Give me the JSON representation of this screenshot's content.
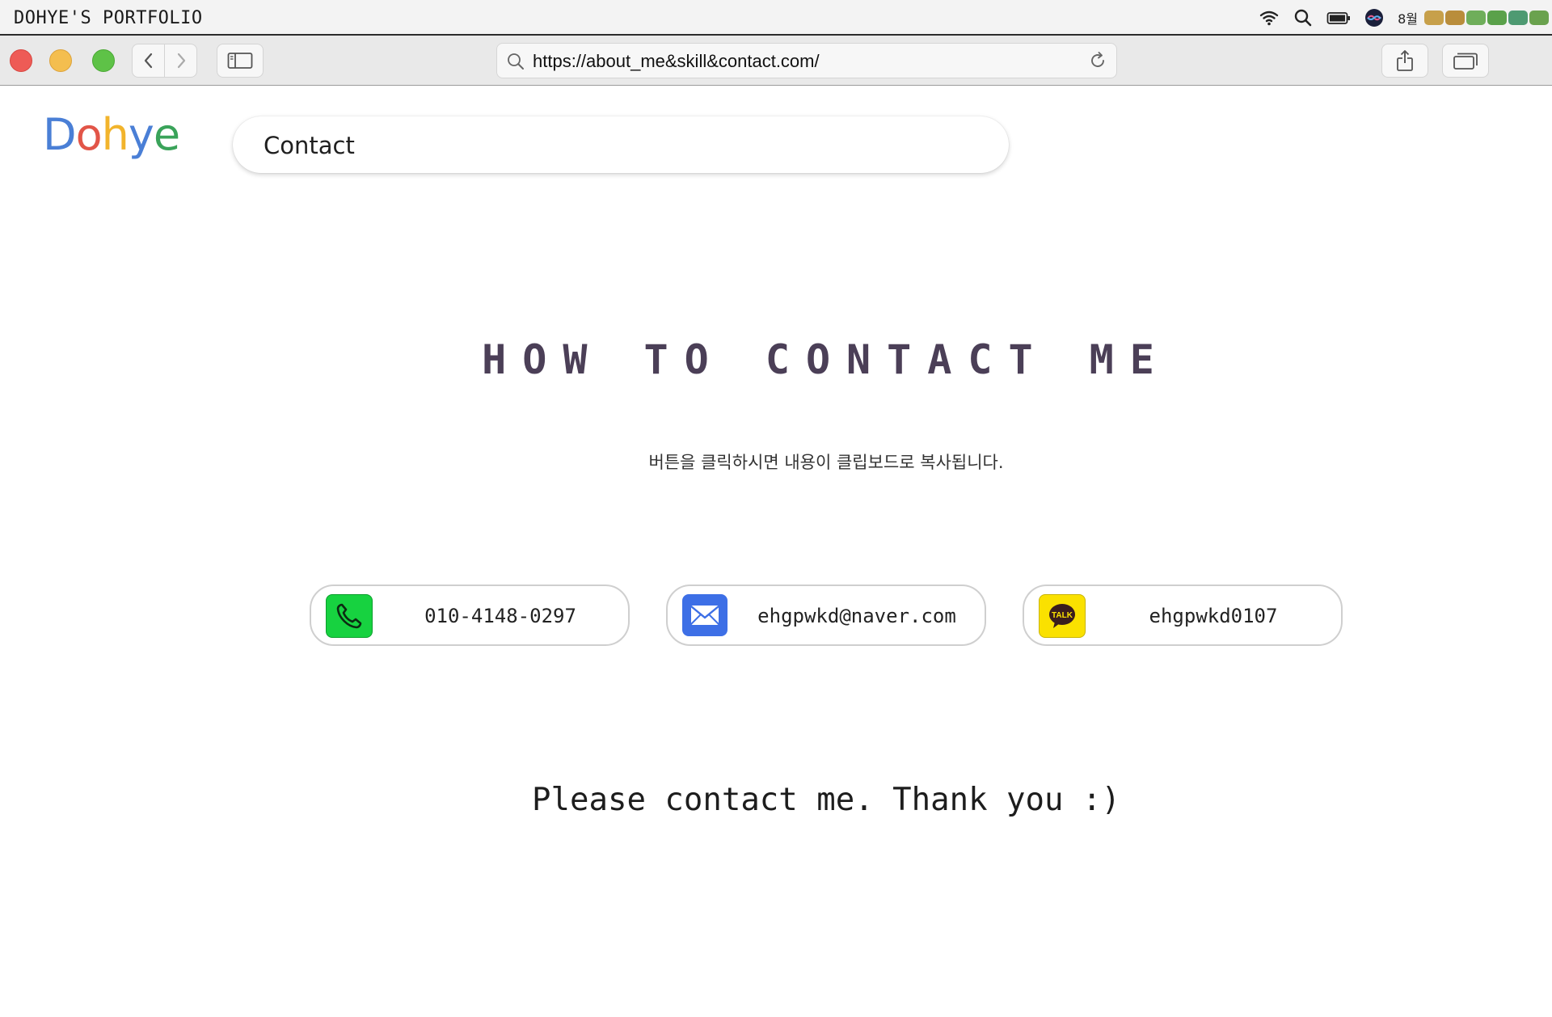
{
  "menubar": {
    "app_title": "DOHYE'S PORTFOLIO",
    "date_text": "8월",
    "icons": [
      "wifi-icon",
      "spotlight-search-icon",
      "battery-icon",
      "siri-icon"
    ]
  },
  "browser": {
    "url": "https://about_me&skill&contact.com/",
    "icons": [
      "back-icon",
      "forward-icon",
      "sidebar-icon",
      "search-icon",
      "reload-icon",
      "share-icon",
      "tabs-icon"
    ]
  },
  "page": {
    "logo": {
      "letters": [
        "D",
        "o",
        "h",
        "y",
        "e"
      ],
      "colors": [
        "#4a7fd6",
        "#e25548",
        "#f2b42c",
        "#4a7fd6",
        "#3aa35a"
      ]
    },
    "search_value": "Contact",
    "heading": "HOW TO CONTACT ME",
    "subtext": "버튼을 클릭하시면 내용이 클립보드로 복사됩니다.",
    "contacts": [
      {
        "type": "phone",
        "icon": "phone-icon",
        "value": "010-4148-0297",
        "color": "#17d240"
      },
      {
        "type": "email",
        "icon": "mail-icon",
        "value": "ehgpwkd@naver.com",
        "color": "#3d6fe6"
      },
      {
        "type": "kakao",
        "icon": "kakaotalk-icon",
        "icon_text": "TALK",
        "value": "ehgpwkd0107",
        "color": "#fae100"
      }
    ],
    "closing": "Please contact me. Thank you :)"
  },
  "colors": {
    "heading": "#4b3f57",
    "card_border": "#cfcfcf",
    "traffic_red": "#ee5b56",
    "traffic_yellow": "#f4be4f",
    "traffic_green": "#5ec247"
  }
}
